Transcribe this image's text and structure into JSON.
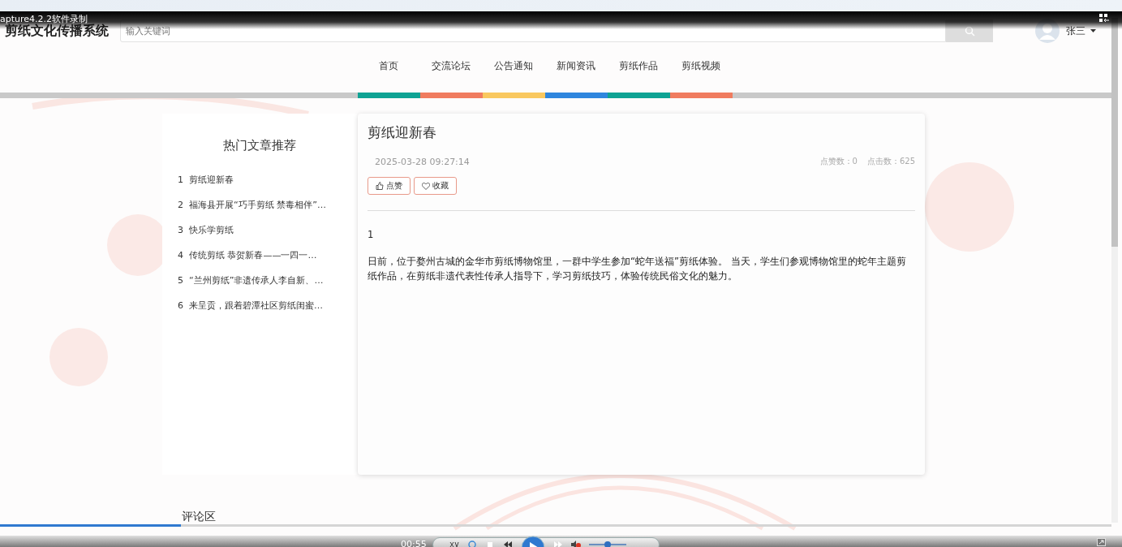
{
  "recorder": {
    "label": "apture4.2.2软件录制"
  },
  "header": {
    "logo": "剪纸文化传播系统",
    "search": {
      "placeholder": "输入关键词"
    },
    "user": {
      "name": "张三"
    }
  },
  "nav": [
    {
      "label": "首页",
      "color": "#0ea394"
    },
    {
      "label": "交流论坛",
      "color": "#f07c5f"
    },
    {
      "label": "公告通知",
      "color": "#f9c85f"
    },
    {
      "label": "新闻资讯",
      "color": "#2e86de"
    },
    {
      "label": "剪纸作品",
      "color": "#0ea394"
    },
    {
      "label": "剪纸视频",
      "color": "#f07c5f"
    }
  ],
  "sidebar": {
    "title": "热门文章推荐",
    "items": [
      {
        "index": "1",
        "title": "剪纸迎新春"
      },
      {
        "index": "2",
        "title": "福海县开展“巧手剪纸 禁毒相伴”…"
      },
      {
        "index": "3",
        "title": "快乐学剪纸"
      },
      {
        "index": "4",
        "title": "传统剪纸 恭贺新春——一四一…"
      },
      {
        "index": "5",
        "title": "“兰州剪纸”非遗传承人李自新、…"
      },
      {
        "index": "6",
        "title": "来呈贡，跟着碧潭社区剪纸闺蜜…"
      }
    ]
  },
  "article": {
    "title": "剪纸迎新春",
    "date": "2025-03-28 09:27:14",
    "stats": [
      "点赞数：0",
      "点击数：625"
    ],
    "buttons": [
      {
        "kind": "like",
        "label": "点赞"
      },
      {
        "kind": "favorite",
        "label": "收藏"
      }
    ],
    "body": [
      "1",
      "日前，位于婺州古城的金华市剪纸博物馆里，一群中学生参加“蛇年送福”剪纸体验。 当天，学生们参观博物馆里的蛇年主题剪纸作品，在剪纸非遗代表性传承人指导下，学习剪纸技巧，体验传统民俗文化的魅力。"
    ]
  },
  "comments": {
    "title": "评论区"
  },
  "player": {
    "time": "00:55",
    "level": 0.163,
    "volume": {
      "level": 0.5
    }
  }
}
